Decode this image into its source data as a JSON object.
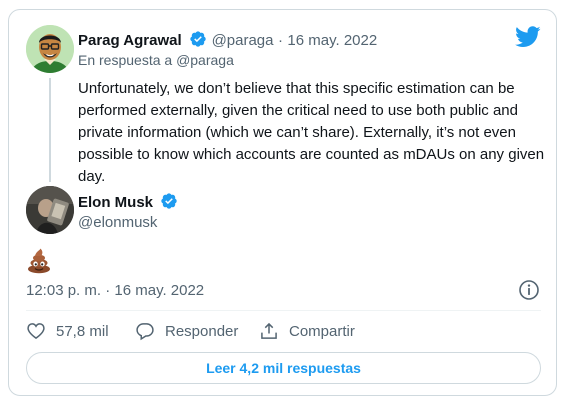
{
  "tweet": {
    "author_name": "Parag Agrawal",
    "author_handle": "@paraga",
    "separator": "·",
    "date": "16 may. 2022",
    "reply_prefix": "En respuesta a",
    "reply_handle": "@paraga",
    "text": "Unfortunately, we don’t believe that this specific estimation can be performed externally, given the critical need to use both public and private information (which we can’t share). Externally, it’s not even possible to know which accounts are counted as mDAUs on any given day."
  },
  "reply": {
    "author_name": "Elon Musk",
    "author_handle": "@elonmusk",
    "emoji": "pile-of-poo",
    "timestamp": "12:03 p. m. · 16 may. 2022"
  },
  "actions": {
    "like_count": "57,8 mil",
    "reply_label": "Responder",
    "share_label": "Compartir"
  },
  "read_replies_label": "Leer 4,2 mil respuestas",
  "colors": {
    "accent": "#1d9bf0",
    "text": "#0f1419",
    "secondary": "#536471",
    "border": "#cfd9de"
  },
  "icons": [
    "verified-badge-icon",
    "twitter-bird-icon",
    "info-icon",
    "heart-icon",
    "reply-bubble-icon",
    "share-icon"
  ]
}
